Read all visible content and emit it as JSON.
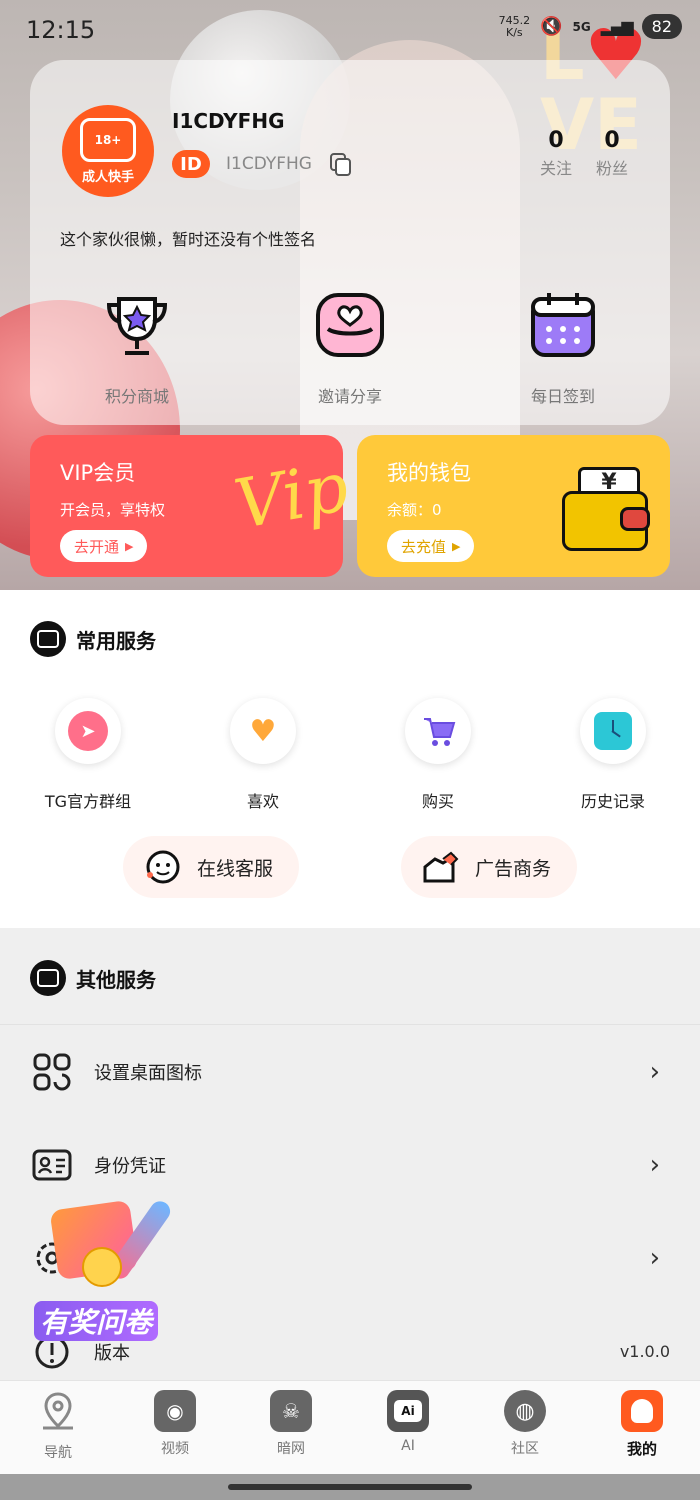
{
  "status_bar": {
    "time": "12:15",
    "net_speed": "745.2\nK/s",
    "signal": "5G",
    "battery": "82"
  },
  "profile": {
    "logo_badge": "18+",
    "logo_text": "成人快手",
    "username": "I1CDYFHG",
    "id_label": "ID",
    "id_value": "I1CDYFHG",
    "follow_count": "0",
    "follow_label": "关注",
    "fans_count": "0",
    "fans_label": "粉丝",
    "bio": "这个家伙很懒，暂时还没有个性签名"
  },
  "quick_actions": [
    {
      "label": "积分商城",
      "icon": "trophy-icon"
    },
    {
      "label": "邀请分享",
      "icon": "heart-hand-icon"
    },
    {
      "label": "每日签到",
      "icon": "calendar-icon"
    }
  ],
  "vip_card": {
    "title": "VIP会员",
    "subtitle": "开会员，享特权",
    "button": "去开通",
    "art": "Vip"
  },
  "wallet_card": {
    "title": "我的钱包",
    "subtitle": "余额：0",
    "button": "去充值",
    "art": "¥"
  },
  "common_services": {
    "title": "常用服务",
    "items": [
      {
        "label": "TG官方群组",
        "icon": "telegram-icon"
      },
      {
        "label": "喜欢",
        "icon": "hearts-icon"
      },
      {
        "label": "购买",
        "icon": "cart-icon"
      },
      {
        "label": "历史记录",
        "icon": "clock-icon"
      }
    ],
    "pills": [
      {
        "label": "在线客服",
        "icon": "support-face-icon"
      },
      {
        "label": "广告商务",
        "icon": "handshake-icon"
      }
    ]
  },
  "other_services": {
    "title": "其他服务",
    "items": [
      {
        "label": "设置桌面图标",
        "icon": "grid-icon"
      },
      {
        "label": "身份凭证",
        "icon": "id-card-icon"
      },
      {
        "label": "",
        "icon": "settings-icon"
      },
      {
        "label": "版本",
        "icon": "info-icon",
        "value": "v1.0.0"
      }
    ]
  },
  "promo": {
    "text": "有奖问卷"
  },
  "tabbar": [
    {
      "label": "导航",
      "icon": "location-pin-icon",
      "active": false
    },
    {
      "label": "视频",
      "icon": "video-camera-icon",
      "active": false
    },
    {
      "label": "暗网",
      "icon": "skull-icon",
      "active": false
    },
    {
      "label": "AI",
      "icon": "ai-icon",
      "active": false
    },
    {
      "label": "社区",
      "icon": "planet-icon",
      "active": false
    },
    {
      "label": "我的",
      "icon": "profile-icon",
      "active": true
    }
  ],
  "colors": {
    "accent": "#ff5a1f",
    "vip": "#ff5a5a",
    "wallet": "#ffc93a"
  }
}
